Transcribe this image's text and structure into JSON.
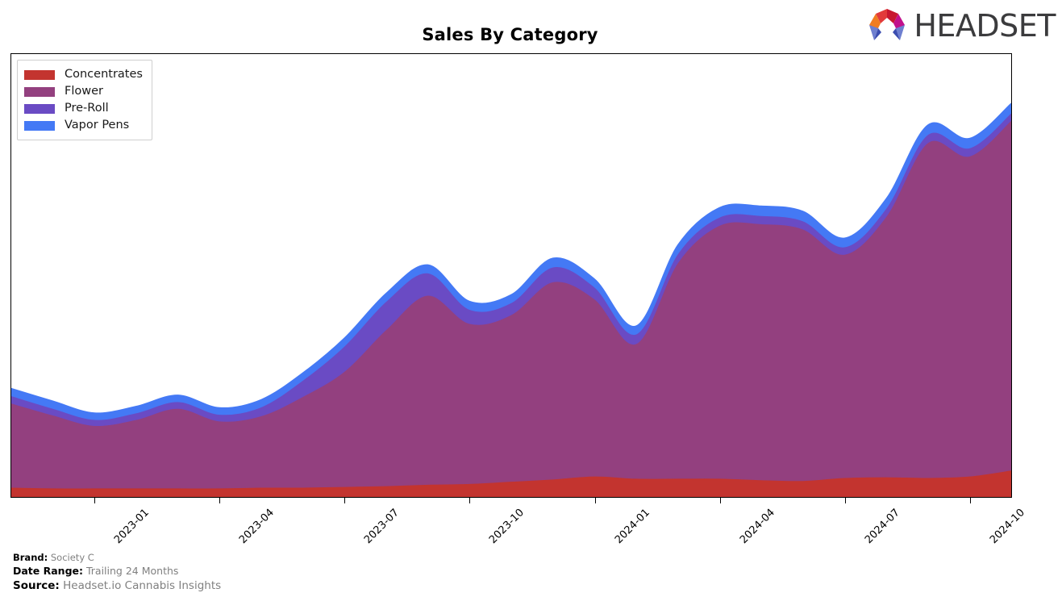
{
  "header": {
    "title": "Sales By Category",
    "logo_text": "HEADSET",
    "logo_mark_name": "headset-logo-mark"
  },
  "legend": {
    "position": "top-left",
    "items": [
      {
        "label": "Concentrates",
        "color": "#c3342f"
      },
      {
        "label": "Flower",
        "color": "#93407f"
      },
      {
        "label": "Pre-Roll",
        "color": "#6a4bc4"
      },
      {
        "label": "Vapor Pens",
        "color": "#4479f5"
      }
    ]
  },
  "footer": {
    "brand_key": "Brand:",
    "brand_value": "Society C",
    "date_range_key": "Date Range:",
    "date_range_value": "Trailing 24 Months",
    "source_key": "Source:",
    "source_value": "Headset.io Cannabis Insights"
  },
  "chart_data": {
    "type": "area",
    "stacked": true,
    "title": "Sales By Category",
    "xlabel": "",
    "ylabel": "",
    "grid": false,
    "legend_position": "top-left",
    "axis_tick_labels": [
      "2023-01",
      "2023-04",
      "2023-07",
      "2023-10",
      "2024-01",
      "2024-04",
      "2024-07",
      "2024-10"
    ],
    "x": [
      "2022-11",
      "2022-12",
      "2023-01",
      "2023-02",
      "2023-03",
      "2023-04",
      "2023-05",
      "2023-06",
      "2023-07",
      "2023-08",
      "2023-09",
      "2023-10",
      "2023-11",
      "2023-12",
      "2024-01",
      "2024-02",
      "2024-03",
      "2024-04",
      "2024-05",
      "2024-06",
      "2024-07",
      "2024-08",
      "2024-09",
      "2024-10",
      "2024-11"
    ],
    "series": [
      {
        "name": "Concentrates",
        "color": "#c3342f",
        "values": [
          13,
          12,
          12,
          12,
          12,
          12,
          13,
          13,
          14,
          15,
          17,
          18,
          21,
          24,
          28,
          25,
          25,
          25,
          23,
          22,
          26,
          27,
          26,
          28,
          36
        ]
      },
      {
        "name": "Flower",
        "color": "#93407f",
        "values": [
          113,
          98,
          84,
          92,
          107,
          90,
          96,
          122,
          155,
          210,
          254,
          215,
          224,
          265,
          238,
          181,
          290,
          340,
          344,
          338,
          300,
          350,
          450,
          430,
          470
        ]
      },
      {
        "name": "Pre-Roll",
        "color": "#6a4bc4",
        "values": [
          10,
          9,
          8,
          9,
          9,
          9,
          12,
          22,
          34,
          38,
          30,
          19,
          16,
          20,
          16,
          13,
          12,
          11,
          11,
          11,
          10,
          11,
          11,
          11,
          10
        ]
      },
      {
        "name": "Vapor Pens",
        "color": "#4479f5",
        "values": [
          10,
          10,
          9,
          9,
          9,
          9,
          10,
          10,
          11,
          11,
          11,
          11,
          11,
          12,
          11,
          11,
          12,
          13,
          13,
          13,
          12,
          13,
          13,
          13,
          13
        ]
      }
    ]
  }
}
